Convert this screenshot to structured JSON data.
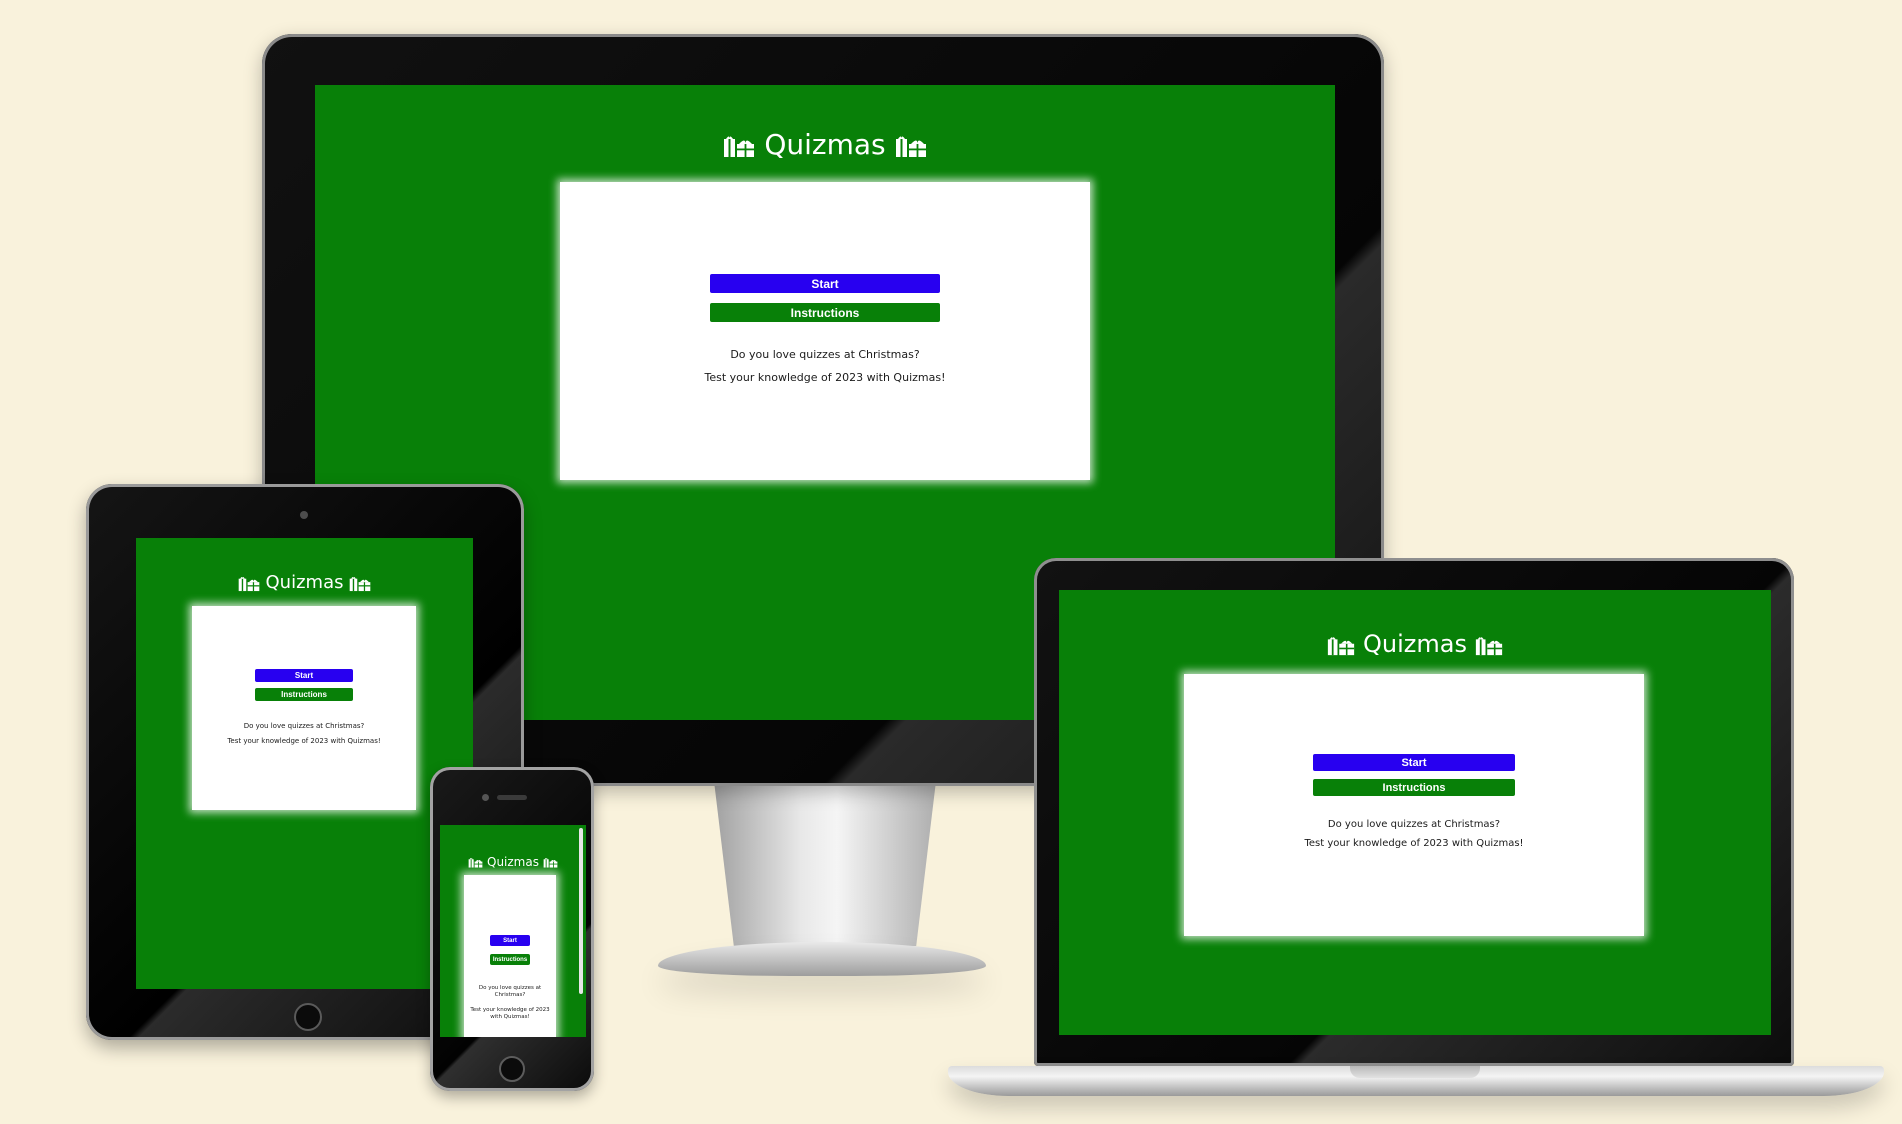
{
  "app": {
    "title": "Quizmas",
    "title_icon": "gift-icon",
    "start_label": "Start",
    "instructions_label": "Instructions",
    "intro_line1": "Do you love quizzes at Christmas?",
    "intro_line2": "Test your knowledge of 2023 with Quizmas!"
  },
  "colors": {
    "background": "#f9f2dc",
    "screen_green": "#088008",
    "start_button": "#2800f0",
    "instructions_button": "#088008",
    "card": "#ffffff"
  }
}
